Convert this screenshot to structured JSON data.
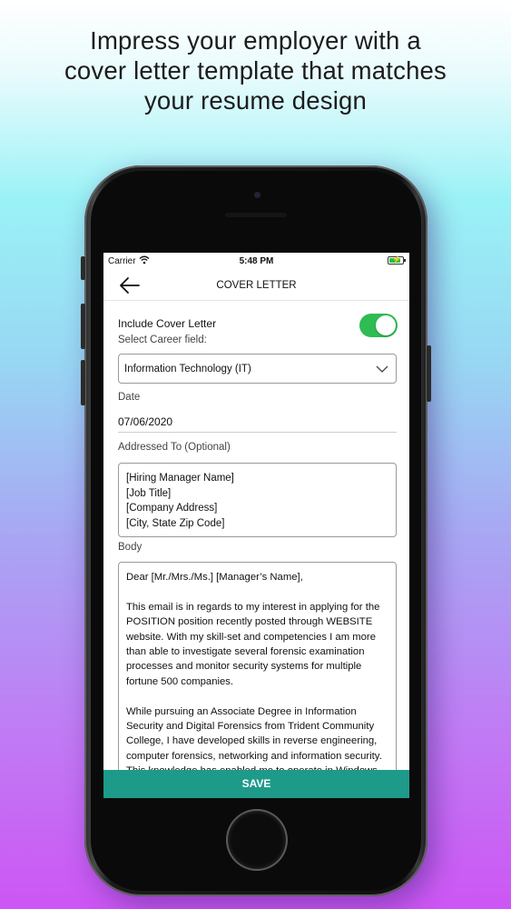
{
  "headline": {
    "line1": "Impress your employer with a",
    "line2": "cover letter template that matches",
    "line3": "your resume design"
  },
  "status_bar": {
    "carrier": "Carrier",
    "time": "5:48 PM"
  },
  "navbar": {
    "title": "COVER LETTER",
    "back_icon": "arrow-left-icon"
  },
  "form": {
    "include_label": "Include Cover Letter",
    "include_enabled": true,
    "career_label": "Select Career field:",
    "career_value": "Information Technology (IT)",
    "date_label": "Date",
    "date_value": "07/06/2020",
    "addressed_label": "Addressed To (Optional)",
    "addressed_lines": [
      "[Hiring Manager Name]",
      "[Job Title]",
      "[Company Address]",
      "[City, State Zip Code]"
    ],
    "body_label": "Body",
    "body_paragraphs": [
      "Dear [Mr./Mrs./Ms.] [Manager’s Name],",
      "This email is in regards to my interest in applying for the POSITION position recently posted through WEBSITE website. With my skill-set and competencies I am more than able to investigate several forensic examination processes and monitor security systems for multiple fortune 500 companies.",
      "While pursuing an Associate Degree in Information Security and Digital Forensics from Trident Community College, I have developed skills in reverse engineering, computer forensics, networking and information security. This knowledge has enabled me to operate in Windows and"
    ]
  },
  "save_label": "SAVE",
  "colors": {
    "accent": "#1e9a8a",
    "toggle": "#2ebc53"
  }
}
